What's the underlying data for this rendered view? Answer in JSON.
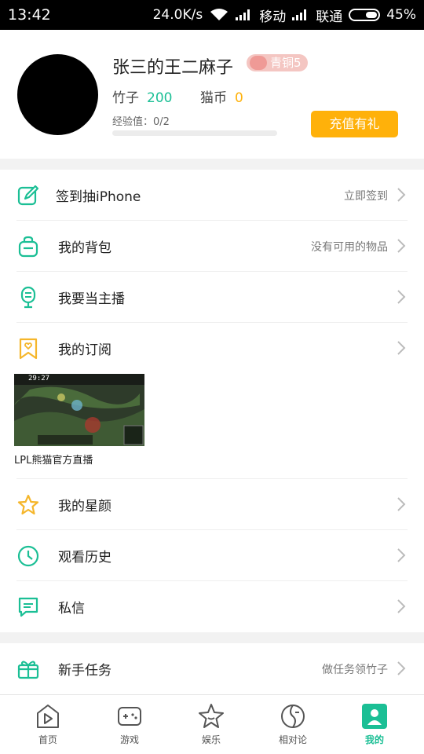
{
  "status_bar": {
    "time": "13:42",
    "speed": "24.0K/s",
    "carrier1": "移动",
    "carrier2": "联通",
    "battery": "45%",
    "battery_level": 0.45
  },
  "profile": {
    "username": "张三的王二麻子",
    "level_badge": "青铜5",
    "bamboo_label": "竹子",
    "bamboo_value": "200",
    "coin_label": "猫币",
    "coin_value": "0",
    "exp_label": "经验值：0/2",
    "exp_progress": 0,
    "recharge_button": "充值有礼"
  },
  "menu": {
    "signin": {
      "label": "签到抽iPhone",
      "right": "立即签到"
    },
    "backpack": {
      "label": "我的背包",
      "right": "没有可用的物品"
    },
    "streamer": {
      "label": "我要当主播"
    },
    "subscription": {
      "label": "我的订阅"
    },
    "subscription_item": {
      "caption": "LPL熊猫官方直播",
      "overlay_text": "29:27"
    },
    "stars": {
      "label": "我的星颜"
    },
    "history": {
      "label": "观看历史"
    },
    "messages": {
      "label": "私信"
    },
    "newbie": {
      "label": "新手任务",
      "right": "做任务领竹子"
    }
  },
  "tabs": [
    {
      "label": "首页"
    },
    {
      "label": "游戏"
    },
    {
      "label": "娱乐"
    },
    {
      "label": "相对论"
    },
    {
      "label": "我的"
    }
  ],
  "colors": {
    "accent": "#1bbf95",
    "orange": "#ffb10a",
    "icon_yellow": "#f5b62b"
  }
}
